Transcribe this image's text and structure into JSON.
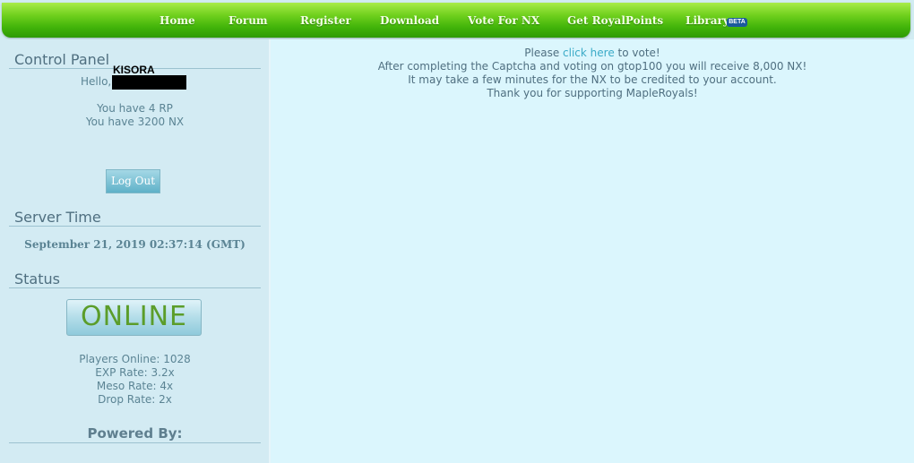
{
  "nav": {
    "items": [
      "Home",
      "Forum",
      "Register",
      "Download",
      "Vote For NX",
      "Get RoyalPoints",
      "Library"
    ],
    "library_badge": "BETA"
  },
  "sidebar": {
    "control_panel_title": "Control Panel",
    "username": "KISORA",
    "hello": "Hello,",
    "rp_text": "You have 4 RP",
    "nx_text": "You have 3200 NX",
    "logout_label": "Log Out",
    "server_time_title": "Server Time",
    "server_time_value": "September 21, 2019 02:37:14 (GMT)",
    "status_title": "Status",
    "status_value": "ONLINE",
    "stats": [
      "Players Online: 1028",
      "EXP Rate: 3.2x",
      "Meso Rate: 4x",
      "Drop Rate: 2x"
    ],
    "powered_by": "Powered By:"
  },
  "main": {
    "line1_prefix": "Please ",
    "line1_link": "click here",
    "line1_suffix": " to vote!",
    "line2": "After completing the Captcha and voting on gtop100 you will receive 8,000 NX!",
    "line3": "It may take a few minutes for the NX to be credited to your account.",
    "line4": "Thank you for supporting MapleRoyals!"
  },
  "colors": {
    "nav_green": "#42b40a",
    "sidebar_bg": "#d3ebf3",
    "main_bg": "#dbf6fd",
    "link": "#3aaac7",
    "online_green": "#5b9d2a"
  }
}
